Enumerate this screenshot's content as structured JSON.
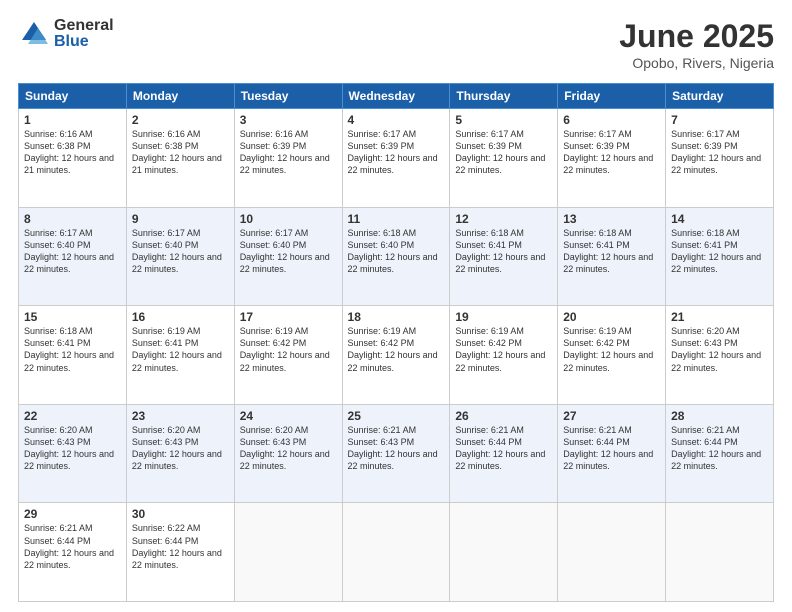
{
  "logo": {
    "general": "General",
    "blue": "Blue"
  },
  "title": "June 2025",
  "location": "Opobo, Rivers, Nigeria",
  "days_header": [
    "Sunday",
    "Monday",
    "Tuesday",
    "Wednesday",
    "Thursday",
    "Friday",
    "Saturday"
  ],
  "weeks": [
    [
      {
        "day": "1",
        "sunrise": "6:16 AM",
        "sunset": "6:38 PM",
        "daylight": "12 hours and 21 minutes."
      },
      {
        "day": "2",
        "sunrise": "6:16 AM",
        "sunset": "6:38 PM",
        "daylight": "12 hours and 21 minutes."
      },
      {
        "day": "3",
        "sunrise": "6:16 AM",
        "sunset": "6:39 PM",
        "daylight": "12 hours and 22 minutes."
      },
      {
        "day": "4",
        "sunrise": "6:17 AM",
        "sunset": "6:39 PM",
        "daylight": "12 hours and 22 minutes."
      },
      {
        "day": "5",
        "sunrise": "6:17 AM",
        "sunset": "6:39 PM",
        "daylight": "12 hours and 22 minutes."
      },
      {
        "day": "6",
        "sunrise": "6:17 AM",
        "sunset": "6:39 PM",
        "daylight": "12 hours and 22 minutes."
      },
      {
        "day": "7",
        "sunrise": "6:17 AM",
        "sunset": "6:39 PM",
        "daylight": "12 hours and 22 minutes."
      }
    ],
    [
      {
        "day": "8",
        "sunrise": "6:17 AM",
        "sunset": "6:40 PM",
        "daylight": "12 hours and 22 minutes."
      },
      {
        "day": "9",
        "sunrise": "6:17 AM",
        "sunset": "6:40 PM",
        "daylight": "12 hours and 22 minutes."
      },
      {
        "day": "10",
        "sunrise": "6:17 AM",
        "sunset": "6:40 PM",
        "daylight": "12 hours and 22 minutes."
      },
      {
        "day": "11",
        "sunrise": "6:18 AM",
        "sunset": "6:40 PM",
        "daylight": "12 hours and 22 minutes."
      },
      {
        "day": "12",
        "sunrise": "6:18 AM",
        "sunset": "6:41 PM",
        "daylight": "12 hours and 22 minutes."
      },
      {
        "day": "13",
        "sunrise": "6:18 AM",
        "sunset": "6:41 PM",
        "daylight": "12 hours and 22 minutes."
      },
      {
        "day": "14",
        "sunrise": "6:18 AM",
        "sunset": "6:41 PM",
        "daylight": "12 hours and 22 minutes."
      }
    ],
    [
      {
        "day": "15",
        "sunrise": "6:18 AM",
        "sunset": "6:41 PM",
        "daylight": "12 hours and 22 minutes."
      },
      {
        "day": "16",
        "sunrise": "6:19 AM",
        "sunset": "6:41 PM",
        "daylight": "12 hours and 22 minutes."
      },
      {
        "day": "17",
        "sunrise": "6:19 AM",
        "sunset": "6:42 PM",
        "daylight": "12 hours and 22 minutes."
      },
      {
        "day": "18",
        "sunrise": "6:19 AM",
        "sunset": "6:42 PM",
        "daylight": "12 hours and 22 minutes."
      },
      {
        "day": "19",
        "sunrise": "6:19 AM",
        "sunset": "6:42 PM",
        "daylight": "12 hours and 22 minutes."
      },
      {
        "day": "20",
        "sunrise": "6:19 AM",
        "sunset": "6:42 PM",
        "daylight": "12 hours and 22 minutes."
      },
      {
        "day": "21",
        "sunrise": "6:20 AM",
        "sunset": "6:43 PM",
        "daylight": "12 hours and 22 minutes."
      }
    ],
    [
      {
        "day": "22",
        "sunrise": "6:20 AM",
        "sunset": "6:43 PM",
        "daylight": "12 hours and 22 minutes."
      },
      {
        "day": "23",
        "sunrise": "6:20 AM",
        "sunset": "6:43 PM",
        "daylight": "12 hours and 22 minutes."
      },
      {
        "day": "24",
        "sunrise": "6:20 AM",
        "sunset": "6:43 PM",
        "daylight": "12 hours and 22 minutes."
      },
      {
        "day": "25",
        "sunrise": "6:21 AM",
        "sunset": "6:43 PM",
        "daylight": "12 hours and 22 minutes."
      },
      {
        "day": "26",
        "sunrise": "6:21 AM",
        "sunset": "6:44 PM",
        "daylight": "12 hours and 22 minutes."
      },
      {
        "day": "27",
        "sunrise": "6:21 AM",
        "sunset": "6:44 PM",
        "daylight": "12 hours and 22 minutes."
      },
      {
        "day": "28",
        "sunrise": "6:21 AM",
        "sunset": "6:44 PM",
        "daylight": "12 hours and 22 minutes."
      }
    ],
    [
      {
        "day": "29",
        "sunrise": "6:21 AM",
        "sunset": "6:44 PM",
        "daylight": "12 hours and 22 minutes."
      },
      {
        "day": "30",
        "sunrise": "6:22 AM",
        "sunset": "6:44 PM",
        "daylight": "12 hours and 22 minutes."
      },
      null,
      null,
      null,
      null,
      null
    ]
  ],
  "labels": {
    "sunrise": "Sunrise: ",
    "sunset": "Sunset: ",
    "daylight": "Daylight: "
  }
}
